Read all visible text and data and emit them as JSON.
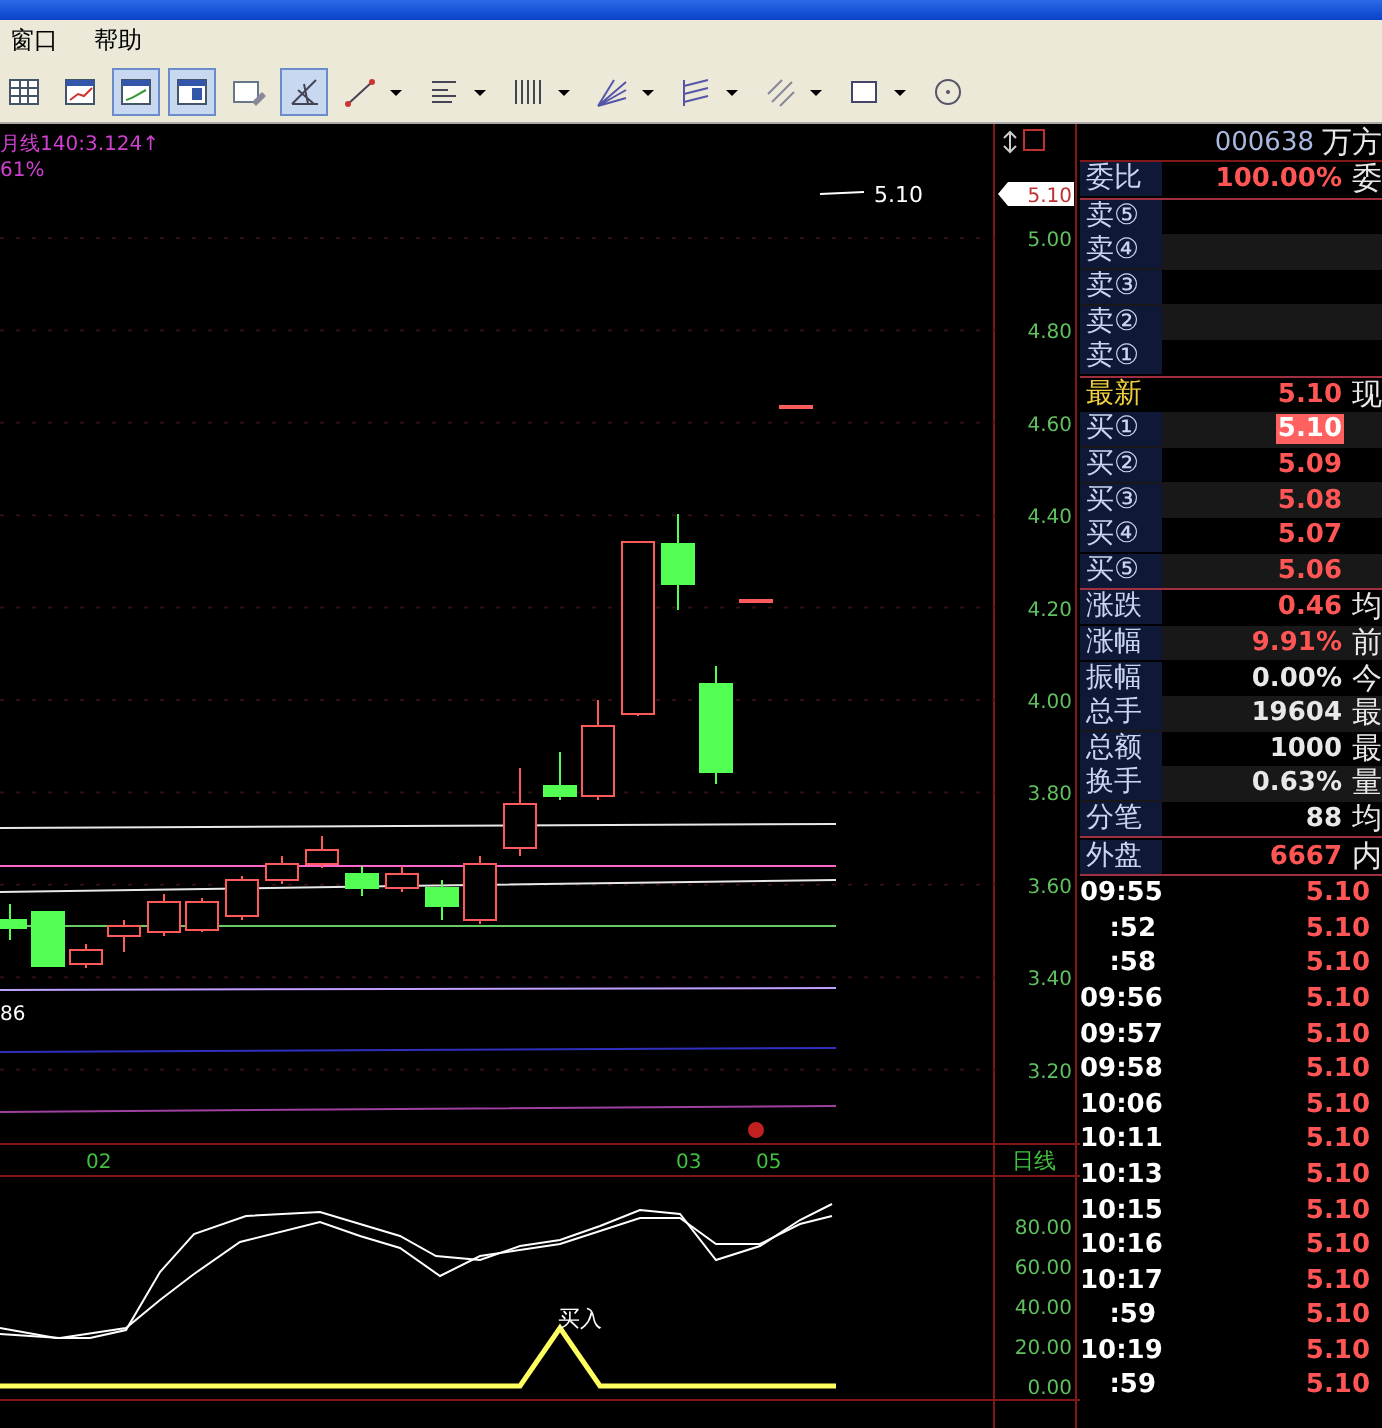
{
  "menu": [
    {
      "label": "窗口"
    },
    {
      "label": "帮助"
    }
  ],
  "toolbar": [
    {
      "kind": "table",
      "selected": false,
      "dropdown": false
    },
    {
      "kind": "chart-window",
      "selected": false,
      "dropdown": false
    },
    {
      "kind": "line-window",
      "selected": true,
      "dropdown": false
    },
    {
      "kind": "split-window",
      "selected": true,
      "dropdown": false
    },
    {
      "kind": "edit-window",
      "selected": false,
      "dropdown": false
    },
    {
      "kind": "draw-tool",
      "selected": true,
      "dropdown": false
    },
    {
      "kind": "line-tool",
      "selected": false,
      "dropdown": true
    },
    {
      "kind": "hlines",
      "selected": false,
      "dropdown": true
    },
    {
      "kind": "vlines",
      "selected": false,
      "dropdown": true
    },
    {
      "kind": "fan",
      "selected": false,
      "dropdown": true
    },
    {
      "kind": "parallel",
      "selected": false,
      "dropdown": true
    },
    {
      "kind": "diagonal",
      "selected": false,
      "dropdown": true
    },
    {
      "kind": "rect",
      "selected": false,
      "dropdown": true
    },
    {
      "kind": "circle",
      "selected": false,
      "dropdown": false
    }
  ],
  "chart": {
    "indicator_label": "月线140:3.124↑",
    "percent_label": "61%",
    "last_price_label": "5.10",
    "left_value": "86",
    "dates": [
      "02",
      "03",
      "05"
    ],
    "signal_label": "买入"
  },
  "axis": {
    "current": "5.10",
    "ticks": [
      "5.00",
      "4.80",
      "4.60",
      "4.40",
      "4.20",
      "4.00",
      "3.80",
      "3.60",
      "3.40",
      "3.20"
    ],
    "period": "日线",
    "indicator_ticks": [
      "80.00",
      "60.00",
      "40.00",
      "20.00",
      "0.00"
    ]
  },
  "quote": {
    "code": "000638",
    "name": "万方",
    "groups": [
      [
        {
          "label": "委比",
          "value": "100.00%",
          "extra": "委",
          "rising": true,
          "highlighted": false
        }
      ],
      [
        {
          "label": "卖⑤"
        },
        {
          "label": "卖④"
        },
        {
          "label": "卖③"
        },
        {
          "label": "卖②"
        },
        {
          "label": "卖①"
        }
      ],
      [
        {
          "label": "最新",
          "value": "5.10",
          "extra": "现",
          "rising": true,
          "highlighted": false,
          "kind": "latest"
        },
        {
          "label": "买①",
          "value": "5.10",
          "rising": true,
          "highlighted": true
        },
        {
          "label": "买②",
          "value": "5.09",
          "rising": true,
          "highlighted": false
        },
        {
          "label": "买③",
          "value": "5.08",
          "rising": true,
          "highlighted": false
        },
        {
          "label": "买④",
          "value": "5.07",
          "rising": true,
          "highlighted": false
        },
        {
          "label": "买⑤",
          "value": "5.06",
          "rising": true,
          "highlighted": false
        }
      ],
      [
        {
          "label": "涨跌",
          "value": "0.46",
          "extra": "均",
          "rising": true,
          "highlighted": false
        },
        {
          "label": "涨幅",
          "value": "9.91%",
          "extra": "前",
          "rising": true,
          "highlighted": false
        },
        {
          "label": "振幅",
          "value": "0.00%",
          "extra": "今",
          "rising": false,
          "highlighted": false
        },
        {
          "label": "总手",
          "value": "19604",
          "extra": "最",
          "rising": false,
          "highlighted": false
        },
        {
          "label": "总额",
          "value": "1000",
          "extra": "最",
          "rising": false,
          "highlighted": false
        },
        {
          "label": "换手",
          "value": "0.63%",
          "extra": "量",
          "rising": false,
          "highlighted": false
        },
        {
          "label": "分笔",
          "value": "88",
          "extra": "均",
          "rising": false,
          "highlighted": false
        }
      ],
      [
        {
          "label": "外盘",
          "value": "6667",
          "extra": "内",
          "rising": true,
          "highlighted": false
        }
      ]
    ],
    "ticks": [
      {
        "time": "09:55",
        "price": "5.10"
      },
      {
        "time": ":52",
        "price": "5.10"
      },
      {
        "time": ":58",
        "price": "5.10"
      },
      {
        "time": "09:56",
        "price": "5.10"
      },
      {
        "time": "09:57",
        "price": "5.10"
      },
      {
        "time": "09:58",
        "price": "5.10"
      },
      {
        "time": "10:06",
        "price": "5.10"
      },
      {
        "time": "10:11",
        "price": "5.10"
      },
      {
        "time": "10:13",
        "price": "5.10"
      },
      {
        "time": "10:15",
        "price": "5.10"
      },
      {
        "time": "10:16",
        "price": "5.10"
      },
      {
        "time": "10:17",
        "price": "5.10"
      },
      {
        "time": ":59",
        "price": "5.10"
      },
      {
        "time": "10:19",
        "price": "5.10"
      },
      {
        "time": ":59",
        "price": "5.10"
      }
    ]
  }
}
